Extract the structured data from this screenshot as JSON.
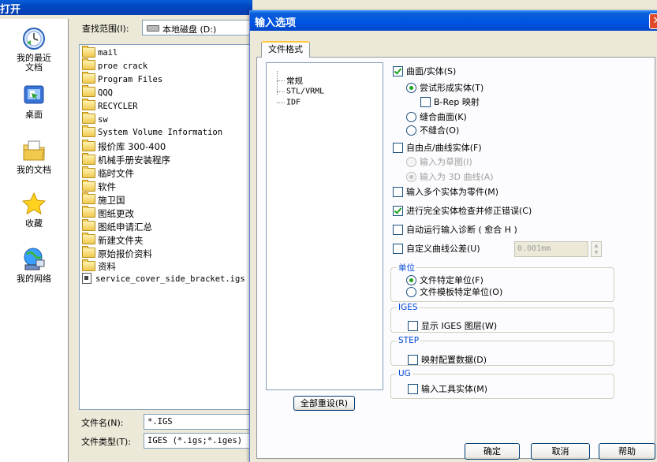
{
  "open_dialog": {
    "title": "打开",
    "places": [
      {
        "label": "我的最近\n文档",
        "icon": "recent-docs-icon"
      },
      {
        "label": "桌面",
        "icon": "desktop-icon"
      },
      {
        "label": "我的文档",
        "icon": "my-documents-icon"
      },
      {
        "label": "收藏",
        "icon": "favorites-star-icon"
      },
      {
        "label": "我的网络",
        "icon": "network-icon"
      }
    ],
    "look_in_label": "查找范围(I):",
    "look_in_value": "本地磁盘  (D:)",
    "files": [
      {
        "name": "mail",
        "type": "folder"
      },
      {
        "name": "proe crack",
        "type": "folder"
      },
      {
        "name": "Program Files",
        "type": "folder"
      },
      {
        "name": "QQQ",
        "type": "folder"
      },
      {
        "name": "RECYCLER",
        "type": "folder"
      },
      {
        "name": "sw",
        "type": "folder"
      },
      {
        "name": "System Volume Information",
        "type": "folder"
      },
      {
        "name": "报价库 300-400",
        "type": "folder"
      },
      {
        "name": "机械手册安装程序",
        "type": "folder"
      },
      {
        "name": "临时文件",
        "type": "folder"
      },
      {
        "name": "软件",
        "type": "folder"
      },
      {
        "name": "施卫国",
        "type": "folder"
      },
      {
        "name": "图纸更改",
        "type": "folder"
      },
      {
        "name": "图纸申请汇总",
        "type": "folder"
      },
      {
        "name": "新建文件夹",
        "type": "folder"
      },
      {
        "name": "原始报价资料",
        "type": "folder"
      },
      {
        "name": "资料",
        "type": "folder"
      },
      {
        "name": "service_cover_side_bracket.igs",
        "type": "file"
      }
    ],
    "filename_label": "文件名(N):",
    "filename_value": "*.IGS",
    "filetype_label": "文件类型(T):",
    "filetype_value": "IGES (*.igs;*.iges)"
  },
  "options_dialog": {
    "title": "输入选项",
    "tab_label": "文件格式",
    "tree": [
      "常规",
      "STL/VRML",
      "IDF"
    ],
    "reset_all": "全部重设(R)",
    "surfaces_solids": "曲面/实体(S)",
    "try_form_solid": "尝试形成实体(T)",
    "brep_map": "B-Rep 映射",
    "knit_surfaces": "缝合曲面(K)",
    "do_not_knit": "不缝合(O)",
    "free_point_curve": "自由点/曲线实体(F)",
    "import_as_sketch": "输入为草图(I)",
    "import_as_3d_curve": "输入为 3D 曲线(A)",
    "import_multi_body": "输入多个实体为零件(M)",
    "full_check": "进行完全实体检查并修正错误(C)",
    "auto_diagnose": "自动运行输入诊断 ( 愈合 H )",
    "custom_tolerance": "自定义曲线公差(U)",
    "tolerance_value": "0.001mm",
    "units_group": "单位",
    "unit_file": "文件特定单位(F)",
    "unit_template": "文件模板特定单位(O)",
    "iges_group": "IGES",
    "show_iges_layers": "显示 IGES 图层(W)",
    "step_group": "STEP",
    "map_config": "映射配置数据(D)",
    "ug_group": "UG",
    "import_tool_bodies": "输入工具实体(M)",
    "ok": "确定",
    "cancel": "取消",
    "help": "帮助"
  }
}
